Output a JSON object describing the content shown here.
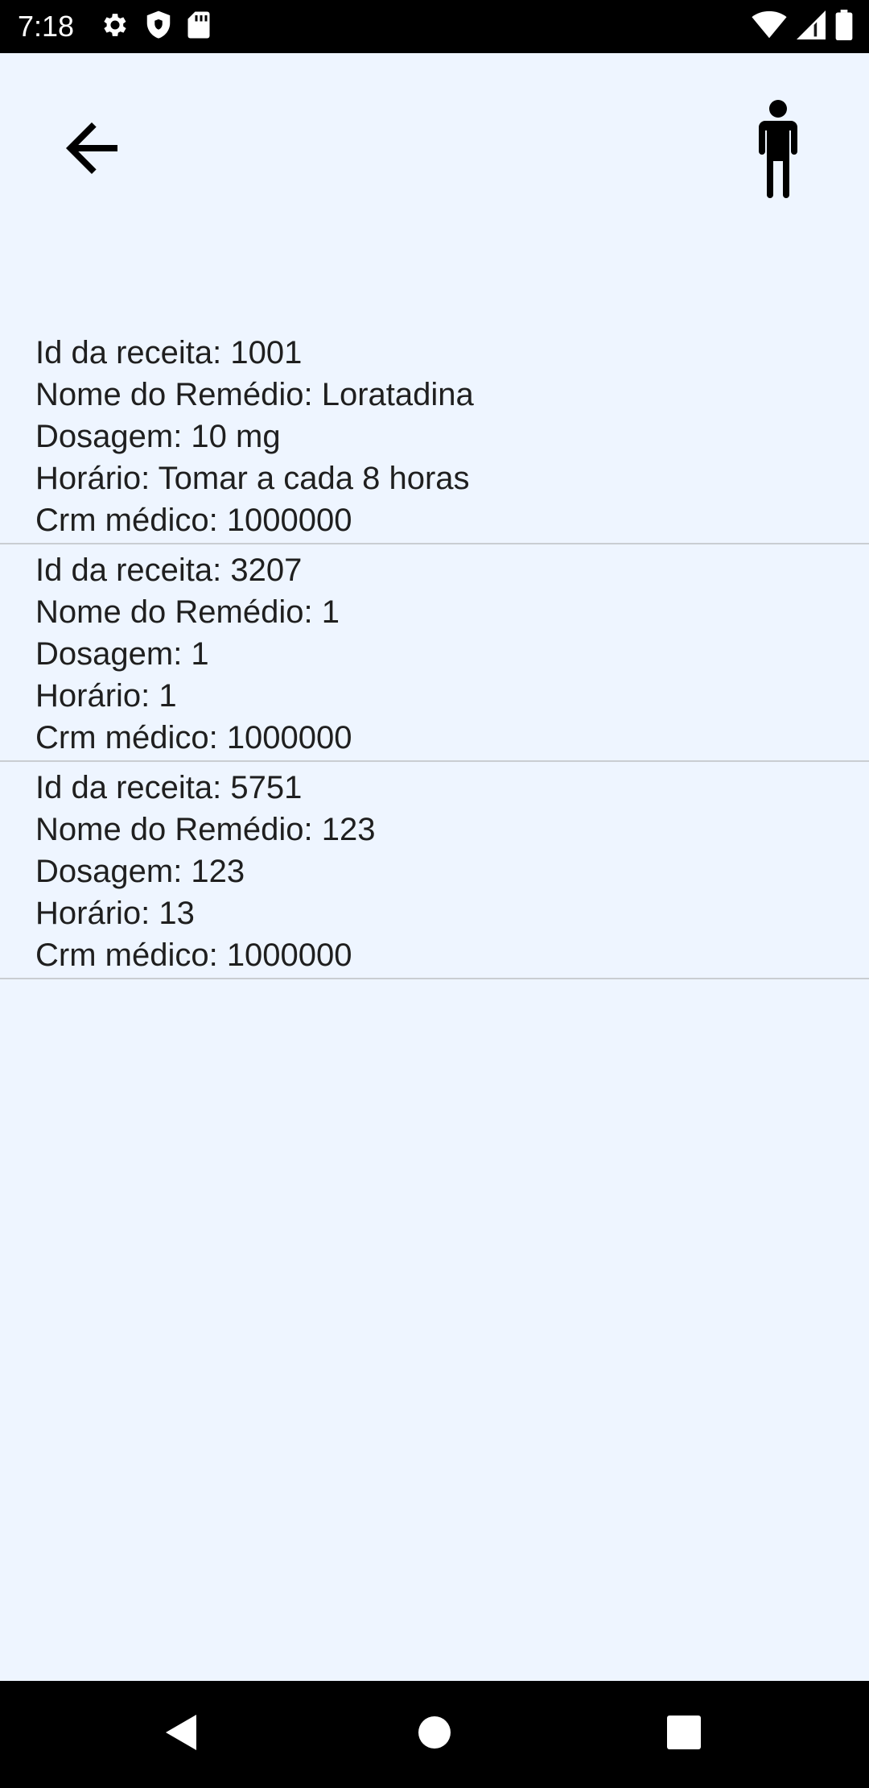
{
  "status_bar": {
    "time": "7:18",
    "left_icons": [
      "gear-icon",
      "shield-icon",
      "sd-card-icon"
    ],
    "right_icons": [
      "wifi-icon",
      "signal-icon",
      "battery-icon"
    ]
  },
  "header": {
    "back_icon": "arrow-left-icon",
    "profile_icon": "person-icon"
  },
  "prescriptions": [
    {
      "id": "Id da receita: 1001",
      "name": "Nome do Remédio: Loratadina",
      "dosage": "Dosagem: 10 mg",
      "schedule": "Horário: Tomar a cada 8 horas",
      "crm": "Crm médico: 1000000"
    },
    {
      "id": "Id da receita: 3207",
      "name": "Nome do Remédio: 1",
      "dosage": "Dosagem: 1",
      "schedule": "Horário: 1",
      "crm": "Crm médico: 1000000"
    },
    {
      "id": "Id da receita: 5751",
      "name": "Nome do Remédio: 123",
      "dosage": "Dosagem: 123",
      "schedule": "Horário: 13",
      "crm": "Crm médico: 1000000"
    }
  ],
  "nav_bar": {
    "back": "triangle-back-icon",
    "home": "circle-home-icon",
    "recents": "square-recents-icon"
  },
  "colors": {
    "background": "#eef5ff",
    "text": "#1f1f1f",
    "divider": "#c9cdd2",
    "bars": "#000000"
  }
}
